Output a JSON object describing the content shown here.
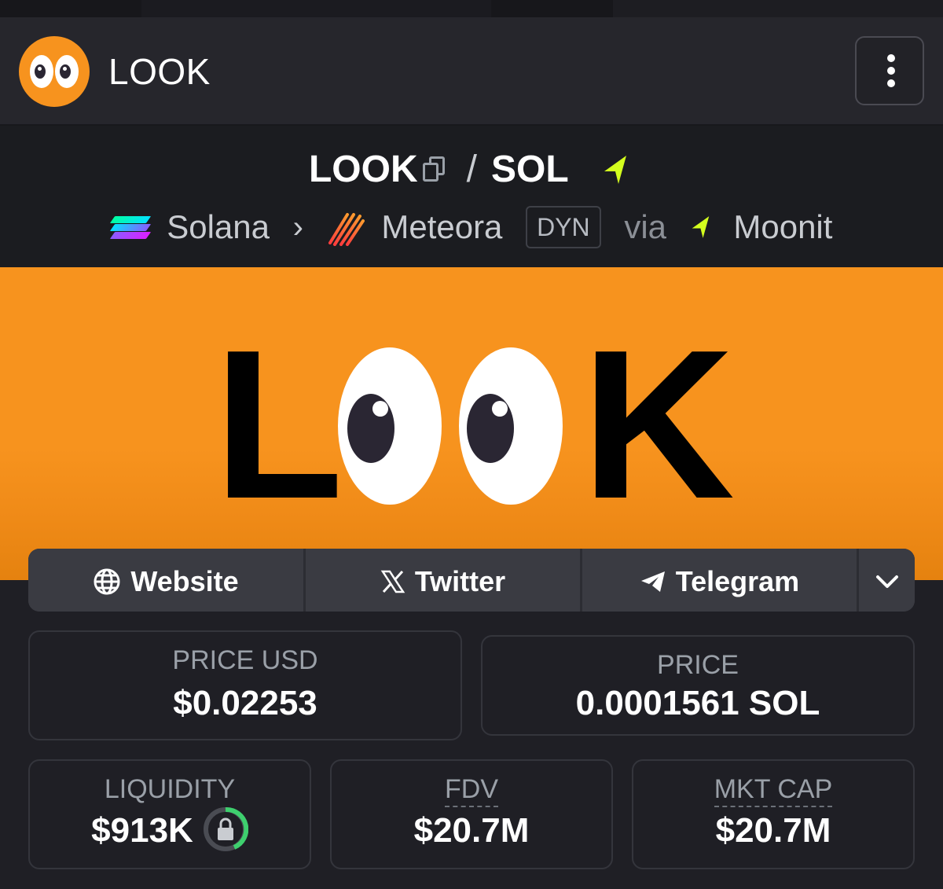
{
  "header": {
    "title": "LOOK"
  },
  "pair": {
    "base": "LOOK",
    "separator": "/",
    "quote": "SOL"
  },
  "route": {
    "chain": "Solana",
    "dex": "Meteora",
    "pool_tag": "DYN",
    "via_label": "via",
    "launchpad": "Moonit"
  },
  "banner": {
    "text_left": "L",
    "text_right": "K"
  },
  "links": [
    {
      "label": "Website",
      "icon": "globe-icon"
    },
    {
      "label": "Twitter",
      "icon": "x-logo-icon"
    },
    {
      "label": "Telegram",
      "icon": "telegram-icon"
    }
  ],
  "stats": {
    "price_usd": {
      "label": "PRICE USD",
      "value": "$0.02253"
    },
    "price_native": {
      "label": "PRICE",
      "value": "0.0001561 SOL"
    },
    "liquidity": {
      "label": "LIQUIDITY",
      "value": "$913K"
    },
    "fdv": {
      "label": "FDV",
      "value": "$20.7M"
    },
    "mkt_cap": {
      "label": "MKT CAP",
      "value": "$20.7M"
    }
  },
  "colors": {
    "brand_orange": "#f7931e",
    "moonit_green": "#d4ff1e",
    "background": "#1f1f25"
  }
}
